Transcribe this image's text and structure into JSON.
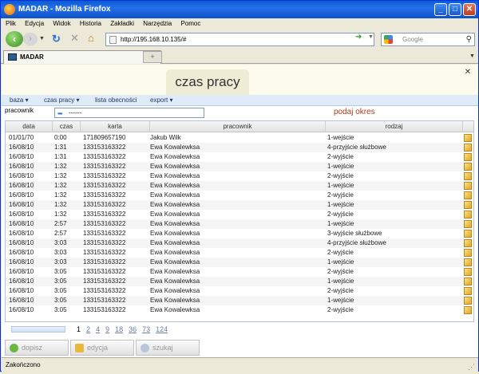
{
  "window": {
    "title": "MADAR - Mozilla Firefox"
  },
  "menu": [
    "Plik",
    "Edycja",
    "Widok",
    "Historia",
    "Zakładki",
    "Narzędzia",
    "Pomoc"
  ],
  "nav": {
    "url": "http://195.168.10.135/#",
    "search_placeholder": "Google"
  },
  "tab": {
    "label": "MADAR"
  },
  "page": {
    "heading": "czas pracy"
  },
  "appmenu": [
    "baza",
    "czas pracy",
    "lista obecności",
    "export"
  ],
  "filter": {
    "label": "pracownik",
    "value": "------",
    "period": "podaj okres"
  },
  "table": {
    "columns": [
      "data",
      "czas",
      "karta",
      "pracownik",
      "rodzaj"
    ],
    "rows": [
      [
        "01/01/70",
        "0:00",
        "171809657190",
        "Jakub Wilk",
        "1-wejście"
      ],
      [
        "16/08/10",
        "1:31",
        "133153163322",
        "Ewa Kowalewksa",
        "4-przyjście służbowe"
      ],
      [
        "16/08/10",
        "1:31",
        "133153163322",
        "Ewa Kowalewksa",
        "2-wyjście"
      ],
      [
        "16/08/10",
        "1:32",
        "133153163322",
        "Ewa Kowalewksa",
        "1-wejście"
      ],
      [
        "16/08/10",
        "1:32",
        "133153163322",
        "Ewa Kowalewksa",
        "2-wyjście"
      ],
      [
        "16/08/10",
        "1:32",
        "133153163322",
        "Ewa Kowalewksa",
        "1-wejście"
      ],
      [
        "16/08/10",
        "1:32",
        "133153163322",
        "Ewa Kowalewksa",
        "2-wyjście"
      ],
      [
        "16/08/10",
        "1:32",
        "133153163322",
        "Ewa Kowalewksa",
        "1-wejście"
      ],
      [
        "16/08/10",
        "1:32",
        "133153163322",
        "Ewa Kowalewksa",
        "2-wyjście"
      ],
      [
        "16/08/10",
        "2:57",
        "133153163322",
        "Ewa Kowalewksa",
        "1-wejście"
      ],
      [
        "16/08/10",
        "2:57",
        "133153163322",
        "Ewa Kowalewksa",
        "3-wyjście służbowe"
      ],
      [
        "16/08/10",
        "3:03",
        "133153163322",
        "Ewa Kowalewksa",
        "4-przyjście służbowe"
      ],
      [
        "16/08/10",
        "3:03",
        "133153163322",
        "Ewa Kowalewksa",
        "2-wyjście"
      ],
      [
        "16/08/10",
        "3:03",
        "133153163322",
        "Ewa Kowalewksa",
        "1-wejście"
      ],
      [
        "16/08/10",
        "3:05",
        "133153163322",
        "Ewa Kowalewksa",
        "2-wyjście"
      ],
      [
        "16/08/10",
        "3:05",
        "133153163322",
        "Ewa Kowalewksa",
        "1-wejście"
      ],
      [
        "16/08/10",
        "3:05",
        "133153163322",
        "Ewa Kowalewksa",
        "2-wyjście"
      ],
      [
        "16/08/10",
        "3:05",
        "133153163322",
        "Ewa Kowalewksa",
        "1-wejście"
      ],
      [
        "16/08/10",
        "3:05",
        "133153163322",
        "Ewa Kowalewksa",
        "2-wyjście"
      ]
    ]
  },
  "pager": {
    "pages": [
      "1",
      "2",
      "4",
      "9",
      "18",
      "36",
      "73",
      "124"
    ],
    "current": "1"
  },
  "actions": {
    "add": "dopisz",
    "edit": "edycja",
    "search": "szukaj"
  },
  "status": {
    "text": "Zakończono"
  },
  "colors": {
    "titlebar": "#0a5bd6",
    "menu_bg": "#dfebf8",
    "heading_bg": "#eeecd5",
    "period_text": "#b03a1a"
  }
}
